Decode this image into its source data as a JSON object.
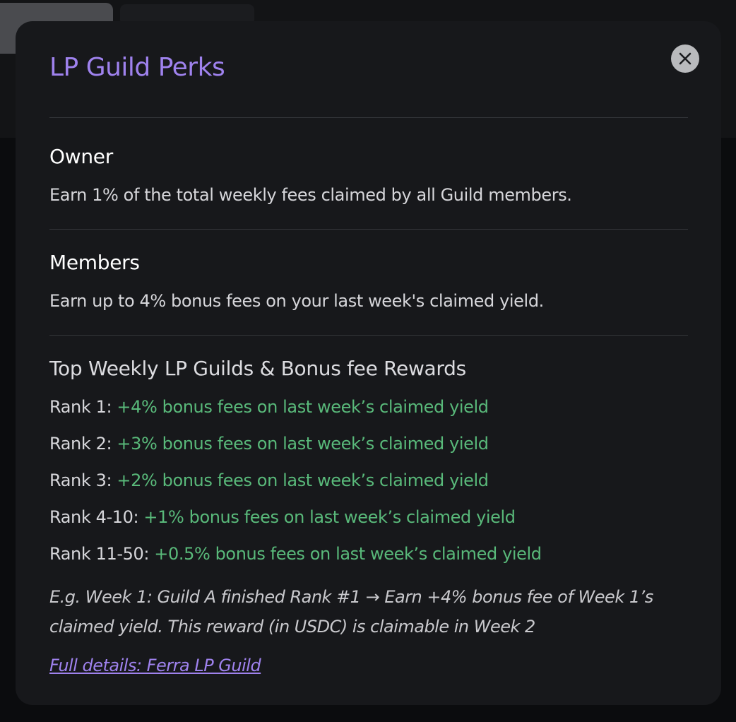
{
  "modal": {
    "title": "LP Guild Perks",
    "close_icon": "close-icon"
  },
  "owner": {
    "heading": "Owner",
    "description": "Earn 1% of the total weekly fees claimed by all Guild members."
  },
  "members": {
    "heading": "Members",
    "description": "Earn up to 4% bonus fees on your last week's claimed yield."
  },
  "rewards": {
    "heading": "Top Weekly LP Guilds & Bonus fee Rewards",
    "ranks": [
      {
        "label": "Rank 1:",
        "reward": "+4% bonus fees on last week’s claimed yield"
      },
      {
        "label": "Rank 2:",
        "reward": "+3% bonus fees on last week’s claimed yield"
      },
      {
        "label": "Rank 3:",
        "reward": "+2% bonus fees on last week’s claimed yield"
      },
      {
        "label": "Rank 4-10:",
        "reward": "+1% bonus fees on last week’s claimed yield"
      },
      {
        "label": "Rank 11-50:",
        "reward": "+0.5% bonus fees on last week’s claimed yield"
      }
    ],
    "example": "E.g. Week 1: Guild A finished Rank #1 → Earn +4% bonus fee of Week 1’s claimed yield. This reward (in USDC) is claimable in Week 2",
    "details_link": "Full details: Ferra LP Guild"
  },
  "colors": {
    "accent": "#9f82ee",
    "reward_green": "#59b97a",
    "modal_bg": "#17181b"
  }
}
